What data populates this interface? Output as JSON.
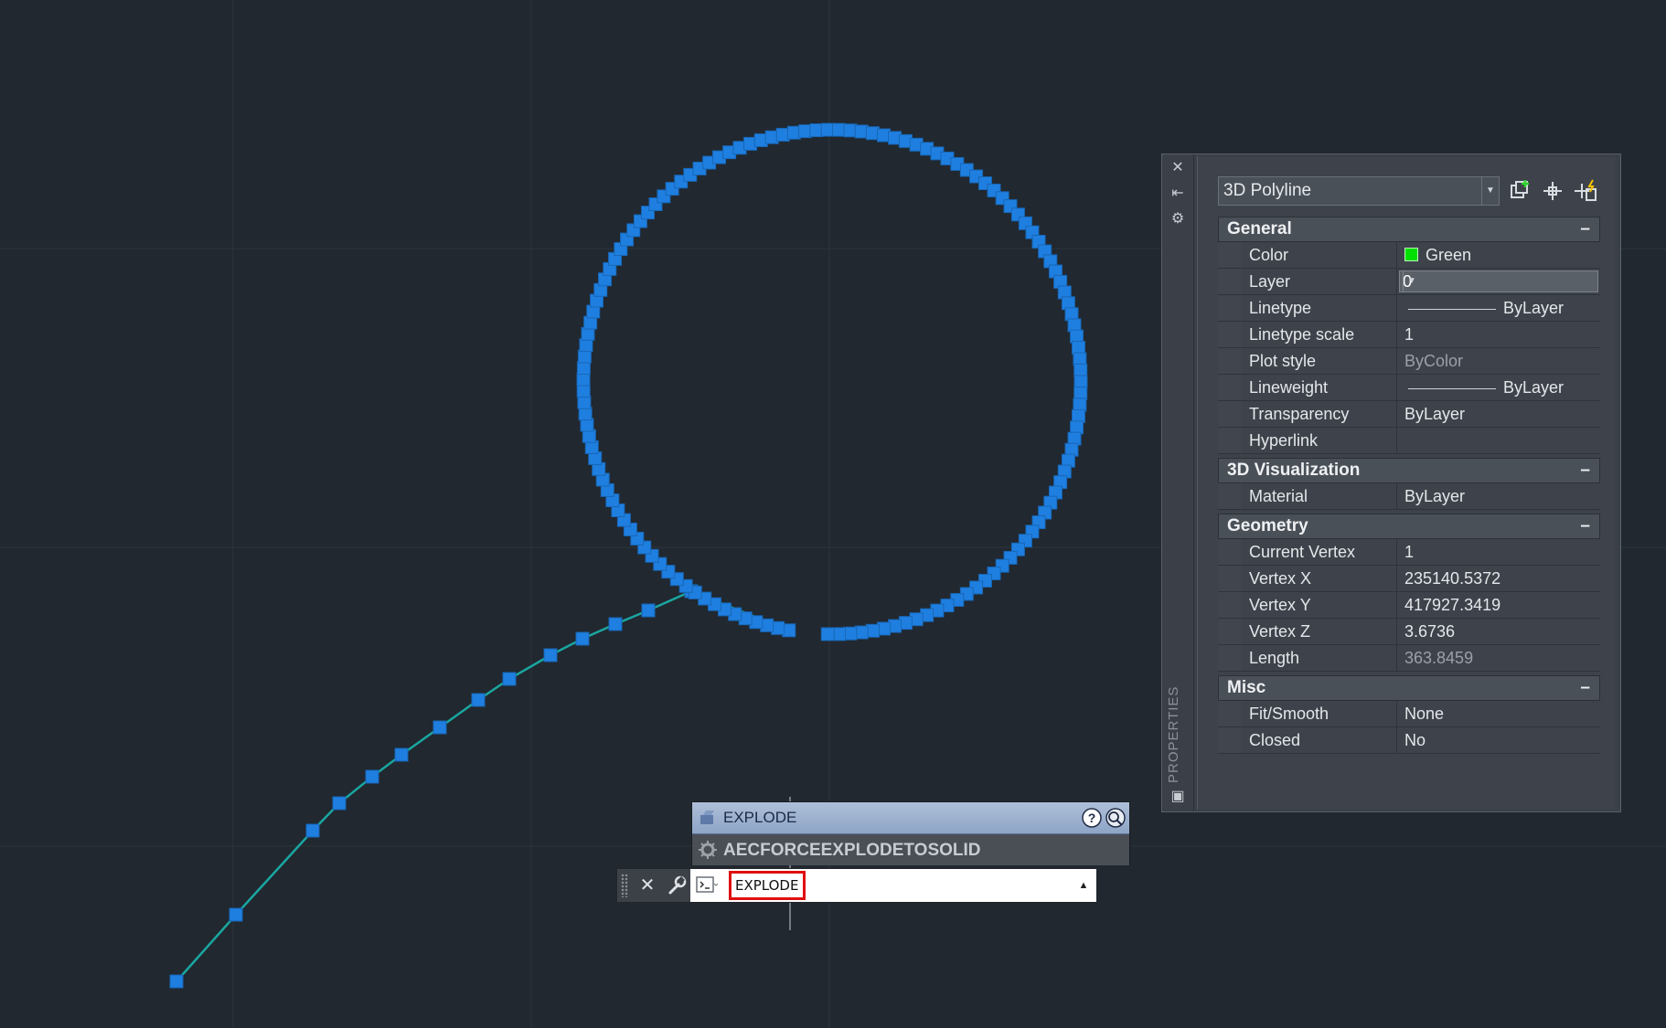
{
  "viewport": {
    "background": "#212830",
    "grid_color": "#2b333d",
    "selected_color": "#1f7fe0",
    "line_color": "#1aa6a0"
  },
  "properties": {
    "palette_title": "PROPERTIES",
    "object_type": "3D Polyline",
    "sections": [
      {
        "title": "General",
        "collapse": "–",
        "rows": [
          {
            "label": "Color",
            "value": "Green",
            "swatch": "#00e000"
          },
          {
            "label": "Layer",
            "value": "0",
            "dropdown": true
          },
          {
            "label": "Linetype",
            "value": "ByLayer",
            "line": true
          },
          {
            "label": "Linetype scale",
            "value": "1"
          },
          {
            "label": "Plot style",
            "value": "ByColor",
            "dim": true
          },
          {
            "label": "Lineweight",
            "value": "ByLayer",
            "line": true
          },
          {
            "label": "Transparency",
            "value": "ByLayer"
          },
          {
            "label": "Hyperlink",
            "value": ""
          }
        ]
      },
      {
        "title": "3D Visualization",
        "collapse": "–",
        "rows": [
          {
            "label": "Material",
            "value": "ByLayer"
          }
        ]
      },
      {
        "title": "Geometry",
        "collapse": "–",
        "rows": [
          {
            "label": "Current Vertex",
            "value": "1"
          },
          {
            "label": "Vertex X",
            "value": "235140.5372"
          },
          {
            "label": "Vertex Y",
            "value": "417927.3419"
          },
          {
            "label": "Vertex Z",
            "value": "3.6736"
          },
          {
            "label": "Length",
            "value": "363.8459",
            "dim": true
          }
        ]
      },
      {
        "title": "Misc",
        "collapse": "–",
        "rows": [
          {
            "label": "Fit/Smooth",
            "value": "None"
          },
          {
            "label": "Closed",
            "value": "No"
          }
        ]
      }
    ]
  },
  "command": {
    "suggestions": [
      "EXPLODE",
      "AECFORCEEXPLODETOSOLID"
    ],
    "input_value": "EXPLODE",
    "close_symbol": "✕",
    "history_symbol": "▲"
  }
}
